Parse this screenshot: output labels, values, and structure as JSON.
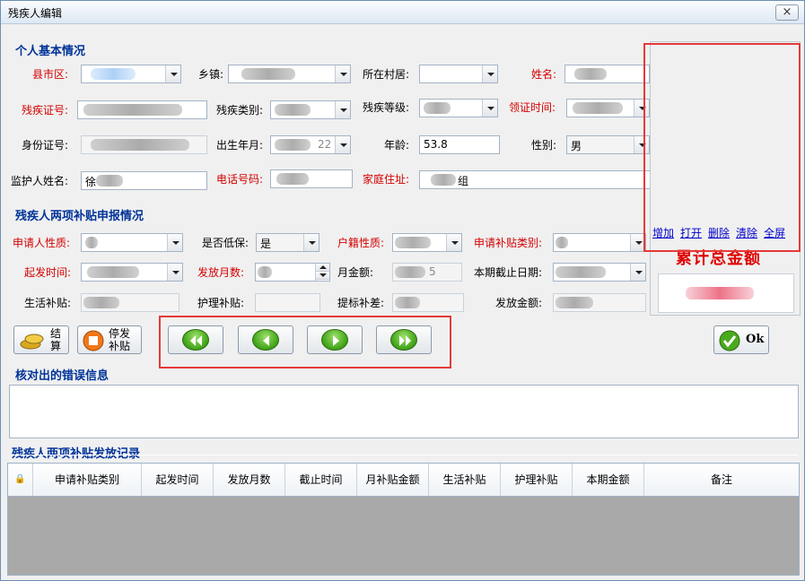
{
  "window": {
    "title": "残疾人编辑",
    "close": "×"
  },
  "sections": {
    "basic": "个人基本情况",
    "subsidy": "残疾人两项补贴申报情况",
    "errors": "核对出的错误信息",
    "records": "残疾人两项补贴发放记录"
  },
  "basic": {
    "county_label": "县市区:",
    "town_label": "乡镇:",
    "village_label": "所在村居:",
    "name_label": "姓名:",
    "card_label": "残疾证号:",
    "type_label": "残疾类别:",
    "level_label": "残疾等级:",
    "issue_label": "领证时间:",
    "id_label": "身份证号:",
    "birth_label": "出生年月:",
    "birth_value": "22",
    "age_label": "年龄:",
    "age_value": "53.8",
    "sex_label": "性别:",
    "sex_value": "男",
    "guardian_label": "监护人姓名:",
    "guardian_value": "徐",
    "phone_label": "电话号码:",
    "addr_label": "家庭住址:",
    "addr_value": "组"
  },
  "subsidy": {
    "nature_label": "申请人性质:",
    "dibao_label": "是否低保:",
    "dibao_value": "是",
    "huji_label": "户籍性质:",
    "category_label": "申请补贴类别:",
    "start_label": "起发时间:",
    "months_label": "发放月数:",
    "monthly_label": "月金额:",
    "monthly_value": "5",
    "enddate_label": "本期截止日期:",
    "living_label": "生活补贴:",
    "nursing_label": "护理补贴:",
    "raise_label": "提标补差:",
    "payout_label": "发放金额:"
  },
  "photo_links": [
    "增加",
    "打开",
    "删除",
    "清除",
    "全屏"
  ],
  "total_title": "累计总金额",
  "buttons": {
    "calc": "结\n算",
    "stop": "停发\n补贴",
    "ok": "Ok"
  },
  "grid": {
    "lock": "🔒",
    "columns": [
      "申请补贴类别",
      "起发时间",
      "发放月数",
      "截止时间",
      "月补贴金额",
      "生活补贴",
      "护理补贴",
      "本期金额",
      "备注"
    ]
  }
}
